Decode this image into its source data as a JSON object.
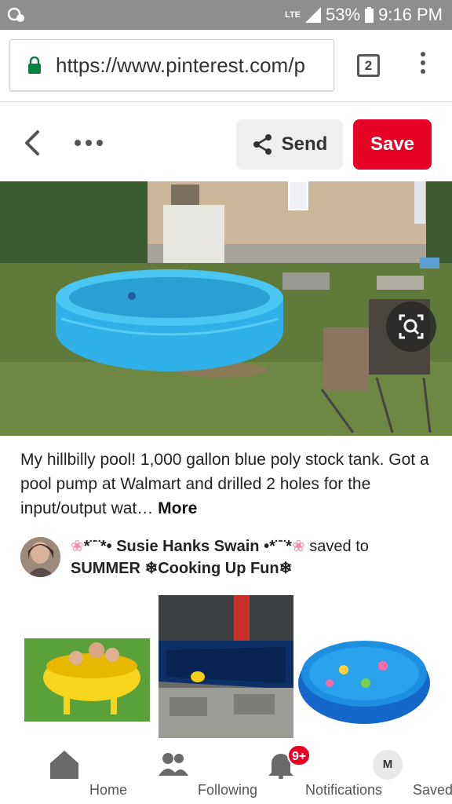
{
  "status_bar": {
    "network": "LTE",
    "battery": "53%",
    "time": "9:16 PM"
  },
  "browser": {
    "url": "https://www.pinterest.com/p",
    "tab_count": "2"
  },
  "pin_header": {
    "send_label": "Send",
    "save_label": "Save"
  },
  "pin": {
    "description": "My hillbilly pool! 1,000 gallon blue poly stock tank. Got a pool pump at Walmart and drilled 2 holes for the input/output wat…",
    "more_label": "More",
    "user_name": "Susie Hanks Swain",
    "user_name_prefix": "*¨¨*•",
    "user_name_suffix": "•*¨¨*",
    "saved_to_text": "saved to",
    "board_name": "SUMMER ❄Cooking Up Fun❄"
  },
  "bottom_nav": {
    "items": [
      {
        "label": "Home",
        "icon": "home-icon"
      },
      {
        "label": "Following",
        "icon": "people-icon"
      },
      {
        "label": "Notifications",
        "icon": "bell-icon"
      },
      {
        "label": "Saved",
        "icon": "profile-avatar"
      }
    ],
    "notification_badge": "9+",
    "profile_initial": "M"
  },
  "colors": {
    "accent_red": "#e60023",
    "status_bar": "#8e8e8e"
  }
}
